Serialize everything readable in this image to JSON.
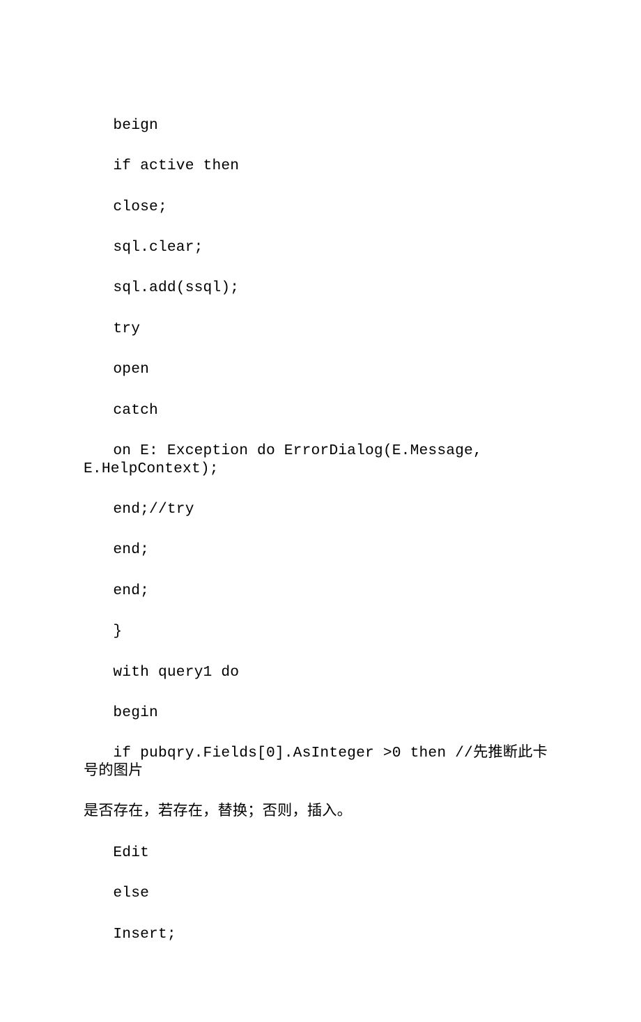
{
  "lines": [
    {
      "text": "beign",
      "indent": true
    },
    {
      "text": "if active then",
      "indent": true
    },
    {
      "text": "close;",
      "indent": true
    },
    {
      "text": "sql.clear;",
      "indent": true
    },
    {
      "text": "sql.add(ssql);",
      "indent": true
    },
    {
      "text": "try",
      "indent": true
    },
    {
      "text": "open",
      "indent": true
    },
    {
      "text": "catch",
      "indent": true
    },
    {
      "text": "on E: Exception do ErrorDialog(E.Message, E.HelpContext);",
      "indent": true
    },
    {
      "text": "end;//try",
      "indent": true
    },
    {
      "text": "end;",
      "indent": true
    },
    {
      "text": "end;",
      "indent": true
    },
    {
      "text": "}",
      "indent": true
    },
    {
      "text": "with query1 do",
      "indent": true
    },
    {
      "text": "begin",
      "indent": true
    },
    {
      "text": "if pubqry.Fields[0].AsInteger >0 then //先推断此卡号的图片",
      "indent": true
    },
    {
      "text": "是否存在，若存在，替换；否则，插入。",
      "indent": false
    },
    {
      "text": "Edit",
      "indent": true
    },
    {
      "text": "else",
      "indent": true
    },
    {
      "text": "Insert;",
      "indent": true
    }
  ]
}
